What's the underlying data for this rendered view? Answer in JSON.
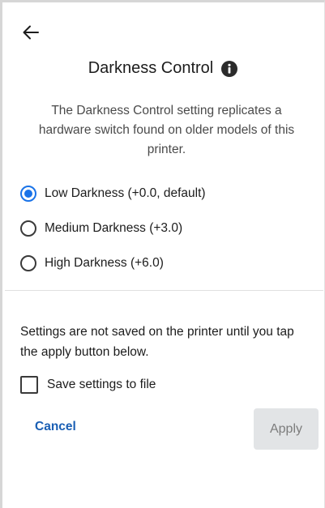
{
  "header": {
    "back_icon": "arrow-left-icon",
    "title": "Darkness Control",
    "info_icon": "info-icon"
  },
  "description": "The Darkness Control setting replicates a hardware switch found on older models of this printer.",
  "darkness_options": [
    {
      "label": "Low Darkness (+0.0, default)",
      "selected": true
    },
    {
      "label": "Medium Darkness (+3.0)",
      "selected": false
    },
    {
      "label": "High Darkness (+6.0)",
      "selected": false
    }
  ],
  "notice": "Settings are not saved on the printer until you tap the apply button below.",
  "save_to_file": {
    "label": "Save settings to file",
    "checked": false
  },
  "actions": {
    "cancel_label": "Cancel",
    "apply_label": "Apply",
    "apply_enabled": false
  },
  "colors": {
    "accent": "#1a73e8",
    "link": "#1a5fb4",
    "disabled_button_bg": "#e2e4e6",
    "disabled_button_text": "#7c7c7c"
  }
}
